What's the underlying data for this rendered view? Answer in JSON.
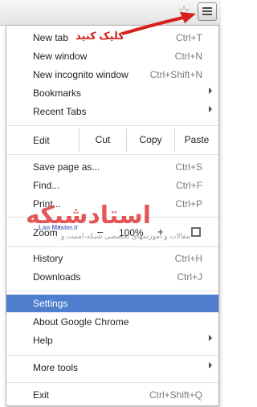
{
  "annotation": {
    "text": "کلیک کنید",
    "color": "#d6201c"
  },
  "watermark": {
    "title": "استادشبکه",
    "url": "Lan Master.ir",
    "subtitle": "مقالات و آموزشهای تخصصی شبکه،امنیت و ..."
  },
  "toolbar": {
    "star_icon": "star-icon",
    "menu_icon": "hamburger-menu-icon"
  },
  "menu": {
    "group1": [
      {
        "label": "New tab",
        "shortcut": "Ctrl+T"
      },
      {
        "label": "New window",
        "shortcut": "Ctrl+N"
      },
      {
        "label": "New incognito window",
        "shortcut": "Ctrl+Shift+N"
      },
      {
        "label": "Bookmarks",
        "shortcut": ""
      },
      {
        "label": "Recent Tabs",
        "shortcut": ""
      }
    ],
    "edit": {
      "label": "Edit",
      "cut": "Cut",
      "copy": "Copy",
      "paste": "Paste"
    },
    "group2": [
      {
        "label": "Save page as...",
        "shortcut": "Ctrl+S"
      },
      {
        "label": "Find...",
        "shortcut": "Ctrl+F"
      },
      {
        "label": "Print...",
        "shortcut": "Ctrl+P"
      }
    ],
    "zoom": {
      "label": "Zoom",
      "minus": "–",
      "value": "100%",
      "plus": "+"
    },
    "group3": [
      {
        "label": "History",
        "shortcut": "Ctrl+H"
      },
      {
        "label": "Downloads",
        "shortcut": "Ctrl+J"
      }
    ],
    "group4": [
      {
        "label": "Settings",
        "shortcut": ""
      },
      {
        "label": "About Google Chrome",
        "shortcut": ""
      },
      {
        "label": "Help",
        "shortcut": ""
      }
    ],
    "group5": [
      {
        "label": "More tools",
        "shortcut": ""
      }
    ],
    "group6": [
      {
        "label": "Exit",
        "shortcut": "Ctrl+Shift+Q"
      }
    ],
    "selected_color": "#4f7ecf"
  }
}
